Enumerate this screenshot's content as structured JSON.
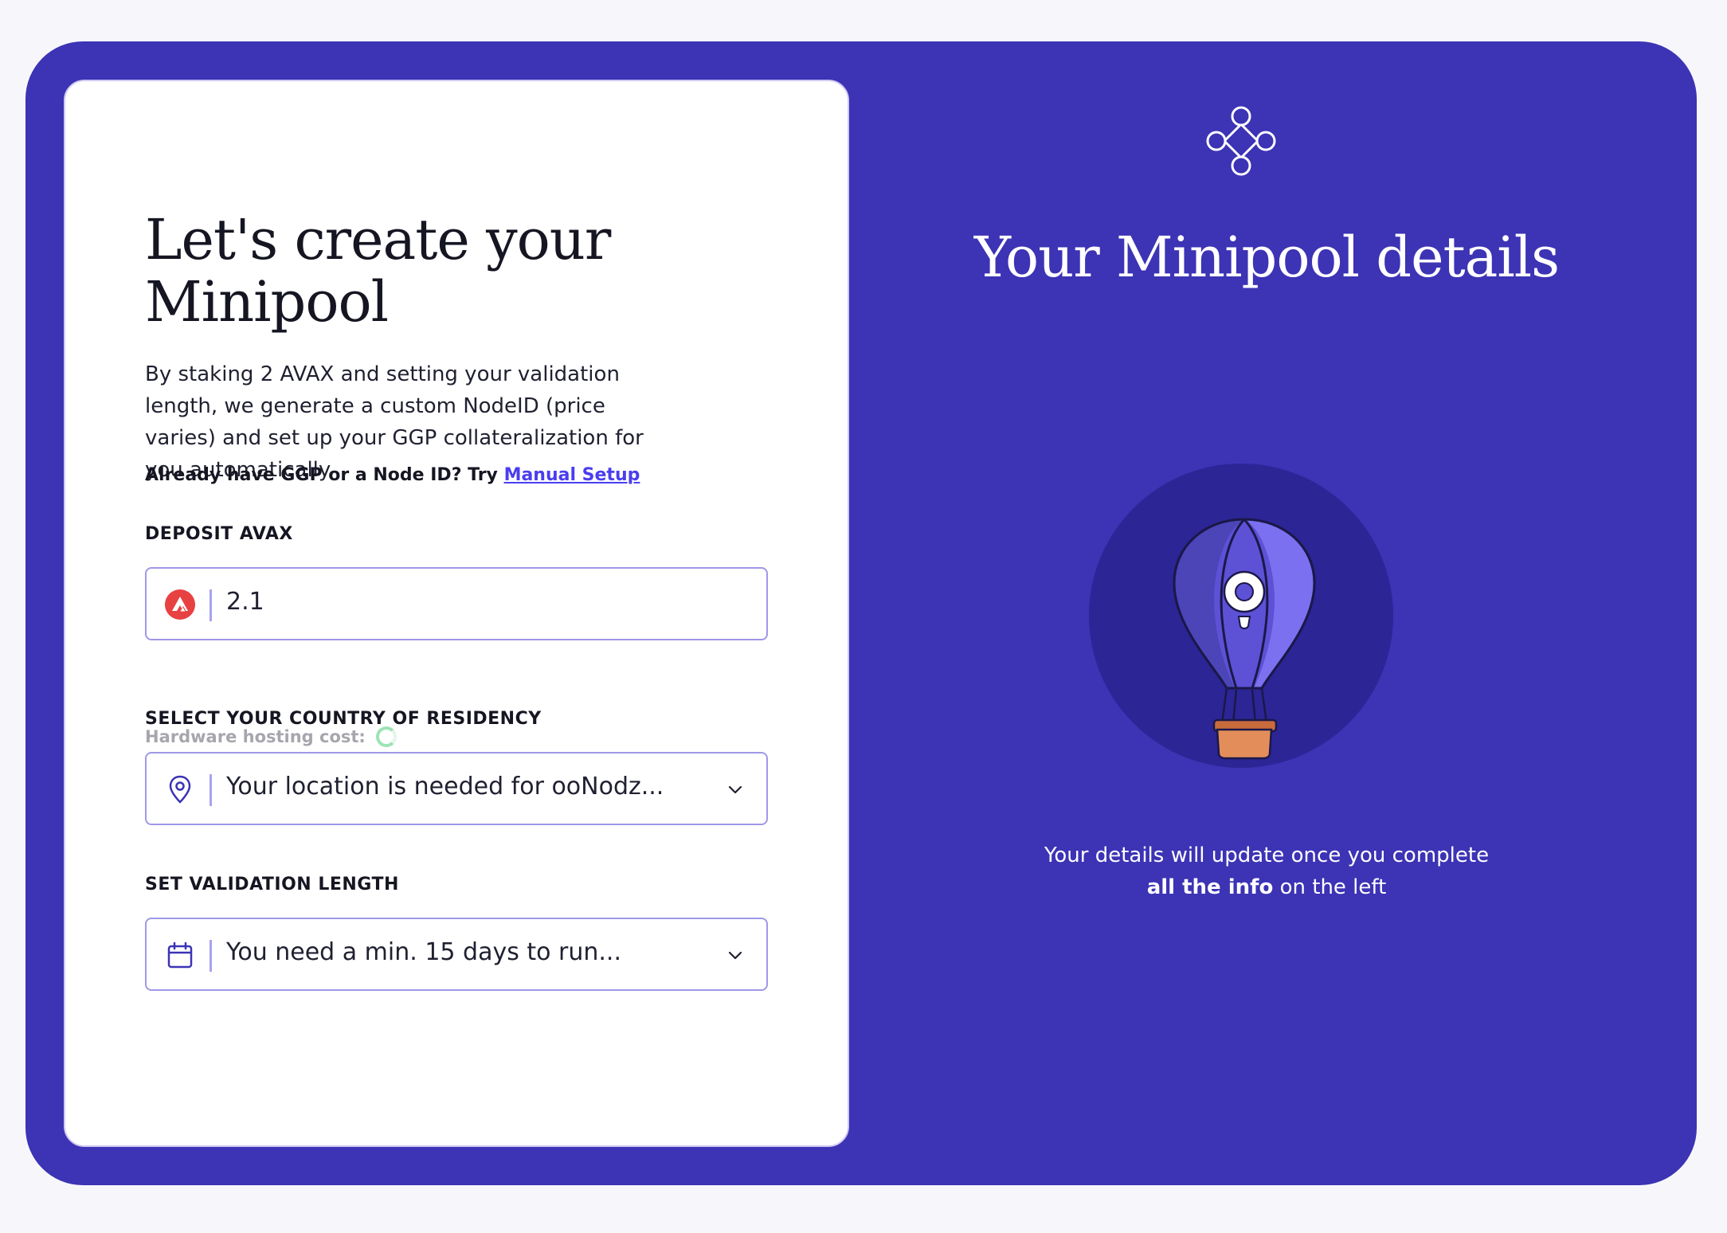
{
  "form": {
    "title_line1": "Let's create your",
    "title_line2": "Minipool",
    "description": "By staking 2 AVAX and setting your validation length, we generate a custom NodeID (price varies) and set up your GGP collateralization for you automatically.",
    "already_text": "Already have GGP or a Node ID? Try",
    "manual_setup_link": "Manual Setup",
    "deposit": {
      "label": "DEPOSIT AVAX",
      "value": "2.1",
      "hosting_cost_label": "Hardware hosting cost:"
    },
    "country": {
      "label": "SELECT YOUR COUNTRY OF RESIDENCY",
      "placeholder": "Your location is needed for ooNodz..."
    },
    "validation": {
      "label": "SET VALIDATION LENGTH",
      "placeholder": "You need a min. 15 days to run..."
    }
  },
  "summary": {
    "title": "Your Minipool details",
    "note_part1": "Your details will update once you complete ",
    "note_bold": "all the info",
    "note_part2": " on the left"
  },
  "icons": {
    "avax": "avalanche-icon",
    "location": "map-pin-icon",
    "calendar": "calendar-icon",
    "chevron": "chevron-down-icon",
    "logo": "nodes-logo-icon",
    "balloon": "hot-air-balloon-illustration"
  },
  "colors": {
    "panel_bg": "#3c33b5",
    "card_bg": "#ffffff",
    "field_border": "#9f98e8",
    "link": "#4a3df0",
    "avax_red": "#e84142",
    "circle_bg": "#2c2596"
  }
}
